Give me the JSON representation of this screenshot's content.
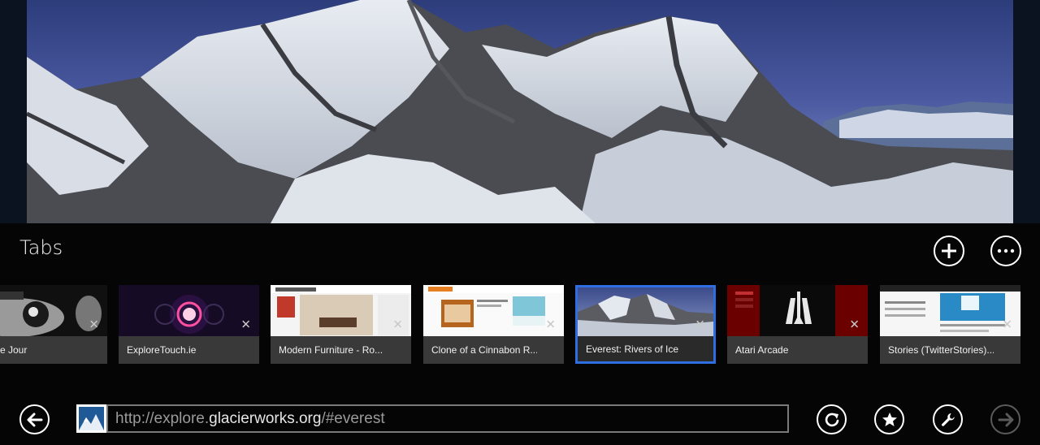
{
  "panel": {
    "title": "Tabs"
  },
  "tabs": [
    {
      "label": "e Jour",
      "close": "✕"
    },
    {
      "label": "ExploreTouch.ie",
      "close": "✕"
    },
    {
      "label": "Modern Furniture - Ro...",
      "close": "✕"
    },
    {
      "label": "Clone of a Cinnabon R...",
      "close": "✕"
    },
    {
      "label": "Everest: Rivers of Ice",
      "close": "✕",
      "selected": true
    },
    {
      "label": "Atari Arcade",
      "close": "✕"
    },
    {
      "label": "Stories (TwitterStories)...",
      "close": "✕"
    }
  ],
  "address": {
    "prefix": "http://explore.",
    "domain": "glacierworks.org",
    "suffix": "/#everest"
  },
  "icons": {
    "new_tab": "plus-icon",
    "more": "ellipsis-icon",
    "back": "arrow-left-icon",
    "refresh": "refresh-icon",
    "favorite": "star-icon",
    "tools": "wrench-icon",
    "forward": "arrow-right-icon"
  },
  "colors": {
    "accent": "#2e6ee0",
    "appbar": "#050505",
    "tab_label_bg": "#393939"
  }
}
